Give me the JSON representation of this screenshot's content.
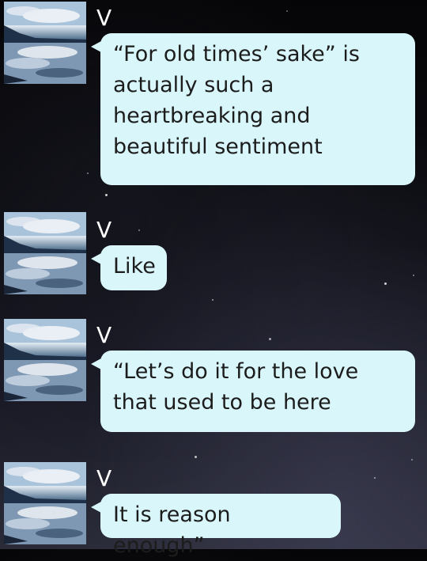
{
  "messages": [
    {
      "sender": "V",
      "avatar_icon": "landscape-photo-icon",
      "text": "“For old times’ sake” is\nactually such a\nheartbreaking and\nbeautiful sentiment"
    },
    {
      "sender": "V",
      "avatar_icon": "landscape-photo-icon",
      "text": "Like"
    },
    {
      "sender": "V",
      "avatar_icon": "landscape-photo-icon",
      "text": "“Let’s do it for the love\nthat used to be here"
    },
    {
      "sender": "V",
      "avatar_icon": "landscape-photo-icon",
      "text": "It is reason enough”"
    }
  ],
  "colors": {
    "bubble_background": "#d9f7fb",
    "bubble_text": "#1c1c1c",
    "sender_text": "#ffffff"
  }
}
